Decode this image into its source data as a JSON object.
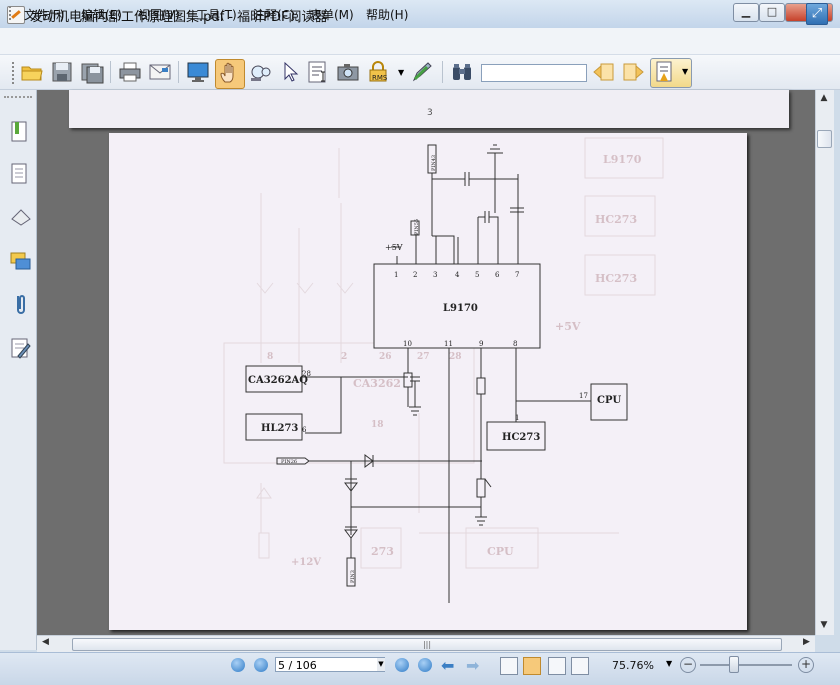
{
  "window": {
    "title": "发动机电脑内部工作原理图集.pdf - 福昕PDF阅读器",
    "minimize": "▁",
    "maximize": "□",
    "close": "✕"
  },
  "menu": {
    "items": [
      "文件(F)",
      "编辑(E)",
      "视图(V)",
      "工具(T)",
      "注释(C)",
      "表单(M)",
      "帮助(H)"
    ]
  },
  "toolbar": {
    "icons": [
      "open-folder-icon",
      "save-icon",
      "save-as-icon",
      "print-icon",
      "email-icon",
      "fullscreen-view-icon",
      "hand-tool-icon",
      "loupe-icon",
      "select-cursor-icon",
      "text-select-icon",
      "snapshot-icon",
      "rms-lock-icon",
      "sign-pen-icon",
      "binoculars-icon",
      "search-prev-icon",
      "search-next-icon",
      "highlight-icon"
    ],
    "rms_label": "RMS",
    "search_value": ""
  },
  "document": {
    "prev_page_number": "3",
    "schematic_labels": {
      "l9170": "L9170",
      "ca3262aq": "CA3262AQ",
      "hl273": "HL273",
      "hc273": "HC273",
      "cpu": "CPU",
      "plus5v": "+5V",
      "pin55": "PIN55",
      "pin43": "PIN43",
      "pin26": "PIN26",
      "pin3": "PIN3",
      "pin_1": "1",
      "pin_2": "2",
      "pin_3": "3",
      "pin_4": "4",
      "pin_5": "5",
      "pin_6": "6",
      "pin_7": "7",
      "pin_10": "10",
      "pin_11": "11",
      "pin_9": "9",
      "pin_8": "8",
      "pin_28": "28",
      "pin_6b": "6",
      "pin_17": "17",
      "pin_1b": "1"
    },
    "ghost_labels": {
      "l9170": "L9170",
      "hc273a": "HC273",
      "hc273b": "HC273",
      "plus5v": "+5V",
      "ca3262": "CA3262",
      "n26": "26",
      "n27": "27",
      "n28": "28",
      "n8": "8",
      "n2": "2",
      "n18": "18",
      "n273": "273",
      "cpu": "CPU",
      "plus12v": "+12V"
    }
  },
  "statusbar": {
    "page_value": "5 / 106",
    "zoom_value": "75.76%"
  }
}
